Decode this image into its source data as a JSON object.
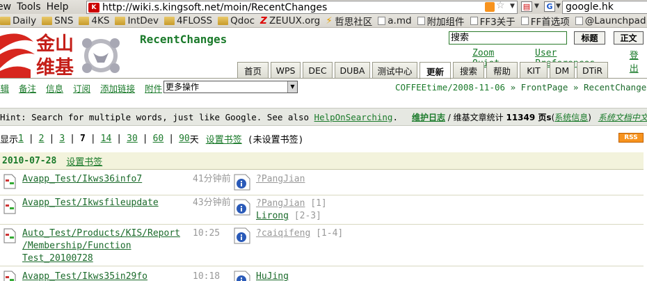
{
  "browser": {
    "menu": [
      "ew",
      "Tools",
      "Help"
    ],
    "url": "http://wiki.s.kingsoft.net/moin/RecentChanges",
    "search_engine_text": "google.hk",
    "bookmarks": [
      {
        "label": "Daily",
        "icon": "folder-icon"
      },
      {
        "label": "SNS",
        "icon": "folder-icon"
      },
      {
        "label": "4KS",
        "icon": "folder-icon"
      },
      {
        "label": "IntDev",
        "icon": "folder-icon"
      },
      {
        "label": "4FLOSS",
        "icon": "folder-icon"
      },
      {
        "label": "Qdoc",
        "icon": "folder-icon"
      },
      {
        "label": "ZEUUX.org",
        "icon": "zeuux-icon"
      },
      {
        "label": "哲思社区",
        "icon": "bolt-icon"
      },
      {
        "label": "a.md",
        "icon": "page-icon"
      },
      {
        "label": "附加组件",
        "icon": "page-icon"
      },
      {
        "label": "FF3关于",
        "icon": "page-icon"
      },
      {
        "label": "FF首选项",
        "icon": "page-icon"
      },
      {
        "label": "@Launchpad",
        "icon": "page-icon"
      }
    ]
  },
  "wiki": {
    "logo_text": "金山维基",
    "title": "RecentChanges",
    "search_placeholder": "搜索",
    "btn_title": "标题",
    "btn_fulltext": "正文",
    "user_links": [
      "Zoom Quiet",
      "User Preferences",
      "登出"
    ],
    "tabs": [
      {
        "label": "首页",
        "active": false
      },
      {
        "label": "WPS",
        "active": false
      },
      {
        "label": "DEC",
        "active": false
      },
      {
        "label": "DUBA",
        "active": false
      },
      {
        "label": "测试中心",
        "active": false
      },
      {
        "label": "更新",
        "active": true
      },
      {
        "label": "搜索",
        "active": false
      },
      {
        "label": "帮助",
        "active": false
      },
      {
        "label": "KIT",
        "active": false
      },
      {
        "label": "DM",
        "active": false
      },
      {
        "label": "DTiR",
        "active": false
      }
    ],
    "actions": [
      "编辑",
      "备注",
      "信息",
      "订阅",
      "添加链接",
      "附件"
    ],
    "more_actions": "更多操作",
    "trail": [
      "COFFEEtime/2008-11-06",
      "FrontPage",
      "RecentChanges"
    ]
  },
  "hint": {
    "text": "Hint: Search for multiple words, just like Google. See also ",
    "link": "HelpOnSearching",
    "end": ".",
    "maint_link": "维护日志",
    "stats_prefix": " / 维基文章统计 ",
    "count": "11349",
    "count_suffix": " 页s",
    "sys_info": "系统信息",
    "translate": "系统文档中文翻译"
  },
  "days": {
    "prefix": "显示",
    "options": [
      "1",
      "2",
      "3",
      "7",
      "14",
      "30",
      "60",
      "90"
    ],
    "selected": "7",
    "suffix": "天",
    "bookmark_link": "设置书签",
    "bookmark_status": "(未设置书签)",
    "rss": "RSS"
  },
  "changes": {
    "date": "2010-07-28",
    "set_bookmark": "设置书签",
    "rows": [
      {
        "page_lines": [
          "Avapp_Test/Ikws36info7"
        ],
        "time": "41分钟前",
        "editors": [
          {
            "name": "?PangJian",
            "known": false,
            "range": ""
          }
        ]
      },
      {
        "page_lines": [
          "Avapp_Test/Ikwsfileupdate"
        ],
        "time": "43分钟前",
        "editors": [
          {
            "name": "?PangJian",
            "known": false,
            "range": "[1]"
          },
          {
            "name": "Lirong",
            "known": true,
            "range": "[2-3]"
          }
        ]
      },
      {
        "page_lines": [
          "Auto_Test/Products/KIS/Report",
          "/Membership/Function",
          "Test_20100728"
        ],
        "time": "10:25",
        "editors": [
          {
            "name": "?caiqifeng",
            "known": false,
            "range": "[1-4]"
          }
        ]
      },
      {
        "page_lines": [
          "Avapp_Test/Ikws35in29fo"
        ],
        "time": "10:18",
        "editors": [
          {
            "name": "HuJing",
            "known": true,
            "range": ""
          }
        ]
      }
    ]
  }
}
